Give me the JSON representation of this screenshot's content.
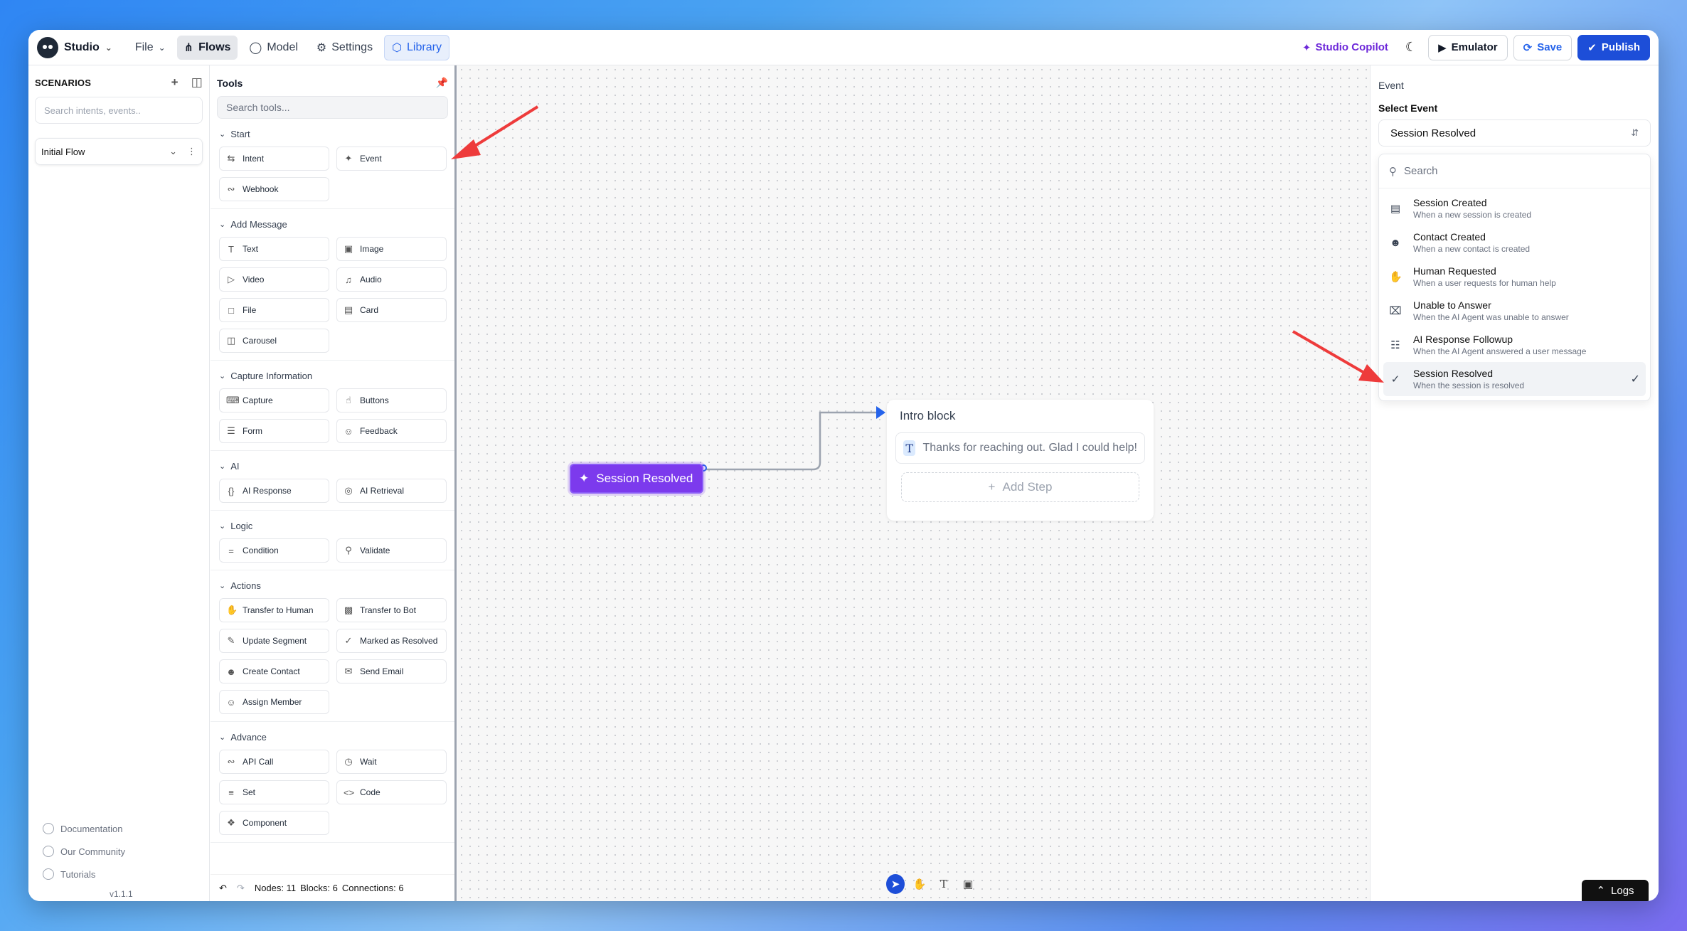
{
  "app": {
    "name": "Studio"
  },
  "menu": {
    "file": "File",
    "flows": "Flows",
    "model": "Model",
    "settings": "Settings",
    "library": "Library"
  },
  "toolbar": {
    "copilot": "Studio Copilot",
    "emulator": "Emulator",
    "save": "Save",
    "publish": "Publish"
  },
  "scenarios": {
    "title": "SCENARIOS",
    "search_placeholder": "Search intents, events..",
    "flow": "Initial Flow"
  },
  "footer": {
    "links": [
      "Documentation",
      "Our Community",
      "Tutorials"
    ],
    "version": "v1.1.1"
  },
  "tools": {
    "title": "Tools",
    "search_placeholder": "Search tools...",
    "sections": [
      {
        "title": "Start",
        "items": [
          "Intent",
          "Event",
          "Webhook"
        ]
      },
      {
        "title": "Add Message",
        "items": [
          "Text",
          "Image",
          "Video",
          "Audio",
          "File",
          "Card",
          "Carousel"
        ]
      },
      {
        "title": "Capture Information",
        "items": [
          "Capture",
          "Buttons",
          "Form",
          "Feedback"
        ]
      },
      {
        "title": "AI",
        "items": [
          "AI Response",
          "AI Retrieval"
        ]
      },
      {
        "title": "Logic",
        "items": [
          "Condition",
          "Validate"
        ]
      },
      {
        "title": "Actions",
        "items": [
          "Transfer to Human",
          "Transfer to Bot",
          "Update Segment",
          "Marked as Resolved",
          "Create Contact",
          "Send Email",
          "Assign Member"
        ]
      },
      {
        "title": "Advance",
        "items": [
          "API Call",
          "Wait",
          "Set",
          "Code",
          "Component"
        ]
      }
    ],
    "status": {
      "nodes": "Nodes: 11",
      "blocks": "Blocks: 6",
      "connections": "Connections: 6"
    }
  },
  "canvas": {
    "event_node": "Session Resolved",
    "block_title": "Intro block",
    "block_message": "Thanks for reaching out. Glad I could help!",
    "add_step": "Add Step"
  },
  "panel": {
    "heading": "Event",
    "label": "Select Event",
    "selected": "Session Resolved",
    "search_placeholder": "Search",
    "options": [
      {
        "name": "Session Created",
        "desc": "When a new session is created",
        "icon": "message-icon"
      },
      {
        "name": "Contact Created",
        "desc": "When a new contact is created",
        "icon": "user-plus-icon"
      },
      {
        "name": "Human Requested",
        "desc": "When a user requests for human help",
        "icon": "hand-icon"
      },
      {
        "name": "Unable to Answer",
        "desc": "When the AI Agent was unable to answer",
        "icon": "message-x-icon"
      },
      {
        "name": "AI Response Followup",
        "desc": "When the AI Agent answered a user message",
        "icon": "messages-icon"
      },
      {
        "name": "Session Resolved",
        "desc": "When the session is resolved",
        "icon": "check-circle-icon"
      }
    ]
  },
  "logs": "Logs",
  "colors": {
    "accent": "#1d4ed8",
    "event_node": "#7c3aed",
    "annotation": "#ee3b3b"
  }
}
